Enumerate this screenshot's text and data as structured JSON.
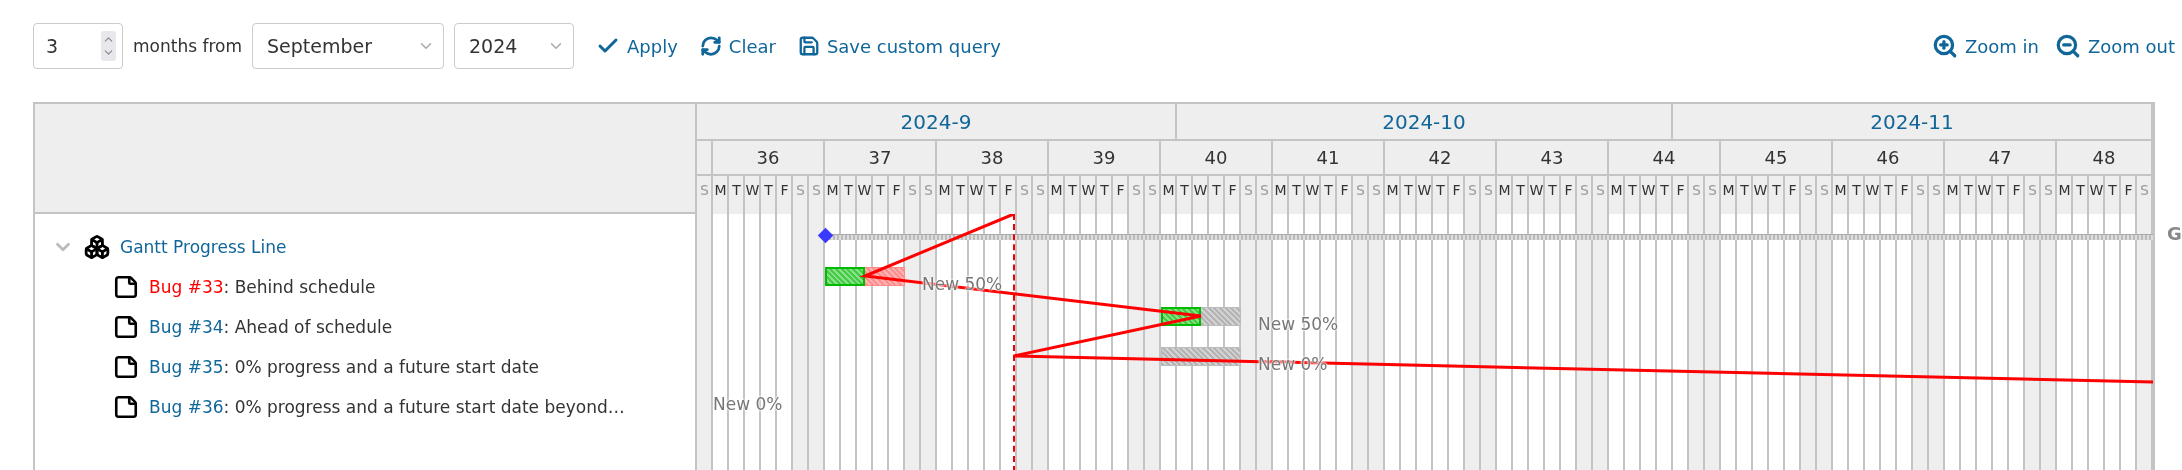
{
  "toolbar": {
    "months": "3",
    "months_label": "months from",
    "month_select": "September",
    "year_select": "2024",
    "actions": [
      {
        "kind": "apply",
        "label": "Apply"
      },
      {
        "kind": "clear",
        "label": "Clear"
      },
      {
        "kind": "save",
        "label": "Save custom query"
      }
    ],
    "zoom": [
      {
        "kind": "in",
        "label": "Zoom in"
      },
      {
        "kind": "out",
        "label": "Zoom out"
      }
    ]
  },
  "project": {
    "name": "Gantt Progress Line",
    "expanded": true,
    "bar_label": "G"
  },
  "issues": [
    {
      "link": "Bug #33",
      "subject": ": Behind schedule",
      "overdue": true,
      "level": 0.5,
      "status": "New 50%"
    },
    {
      "link": "Bug #34",
      "subject": ": Ahead of schedule",
      "overdue": false,
      "level": 0.5,
      "status": "New 50%"
    },
    {
      "link": "Bug #35",
      "subject": ": 0% progress and a future start date",
      "overdue": false,
      "status": "New 0%"
    },
    {
      "link": "Bug #36",
      "subject": ": 0% progress and a future start date beyond…",
      "overdue": false,
      "status": "New 0%"
    }
  ],
  "chart": {
    "months": [
      {
        "label": "2024-9"
      },
      {
        "label": "2024-10"
      },
      {
        "label": "2024-11"
      }
    ],
    "weeks": [
      {
        "days": [
          {
            "letter": "S",
            "weekend": true
          }
        ]
      },
      {
        "label": "36",
        "days": [
          {
            "letter": "M",
            "weekend": false
          },
          {
            "letter": "T",
            "weekend": false
          },
          {
            "letter": "W",
            "weekend": false
          },
          {
            "letter": "T",
            "weekend": false
          },
          {
            "letter": "F",
            "weekend": false
          },
          {
            "letter": "S",
            "weekend": true
          },
          {
            "letter": "S",
            "weekend": true
          }
        ]
      },
      {
        "label": "37",
        "days": [
          {
            "letter": "M",
            "weekend": false
          },
          {
            "letter": "T",
            "weekend": false
          },
          {
            "letter": "W",
            "weekend": false
          },
          {
            "letter": "T",
            "weekend": false
          },
          {
            "letter": "F",
            "weekend": false
          },
          {
            "letter": "S",
            "weekend": true
          },
          {
            "letter": "S",
            "weekend": true
          }
        ]
      },
      {
        "label": "38",
        "days": [
          {
            "letter": "M",
            "weekend": false
          },
          {
            "letter": "T",
            "weekend": false
          },
          {
            "letter": "W",
            "weekend": false
          },
          {
            "letter": "T",
            "weekend": false
          },
          {
            "letter": "F",
            "weekend": false
          },
          {
            "letter": "S",
            "weekend": true
          },
          {
            "letter": "S",
            "weekend": true
          }
        ]
      },
      {
        "label": "39",
        "days": [
          {
            "letter": "M",
            "weekend": false
          },
          {
            "letter": "T",
            "weekend": false
          },
          {
            "letter": "W",
            "weekend": false
          },
          {
            "letter": "T",
            "weekend": false
          },
          {
            "letter": "F",
            "weekend": false
          },
          {
            "letter": "S",
            "weekend": true
          },
          {
            "letter": "S",
            "weekend": true
          }
        ]
      },
      {
        "label": "40",
        "days": [
          {
            "letter": "M",
            "weekend": false
          },
          {
            "letter": "T",
            "weekend": false
          },
          {
            "letter": "W",
            "weekend": false
          },
          {
            "letter": "T",
            "weekend": false
          },
          {
            "letter": "F",
            "weekend": false
          },
          {
            "letter": "S",
            "weekend": true
          },
          {
            "letter": "S",
            "weekend": true
          }
        ]
      },
      {
        "label": "41",
        "days": [
          {
            "letter": "M",
            "weekend": false
          },
          {
            "letter": "T",
            "weekend": false
          },
          {
            "letter": "W",
            "weekend": false
          },
          {
            "letter": "T",
            "weekend": false
          },
          {
            "letter": "F",
            "weekend": false
          },
          {
            "letter": "S",
            "weekend": true
          },
          {
            "letter": "S",
            "weekend": true
          }
        ]
      },
      {
        "label": "42",
        "days": [
          {
            "letter": "M",
            "weekend": false
          },
          {
            "letter": "T",
            "weekend": false
          },
          {
            "letter": "W",
            "weekend": false
          },
          {
            "letter": "T",
            "weekend": false
          },
          {
            "letter": "F",
            "weekend": false
          },
          {
            "letter": "S",
            "weekend": true
          },
          {
            "letter": "S",
            "weekend": true
          }
        ]
      },
      {
        "label": "43",
        "days": [
          {
            "letter": "M",
            "weekend": false
          },
          {
            "letter": "T",
            "weekend": false
          },
          {
            "letter": "W",
            "weekend": false
          },
          {
            "letter": "T",
            "weekend": false
          },
          {
            "letter": "F",
            "weekend": false
          },
          {
            "letter": "S",
            "weekend": true
          },
          {
            "letter": "S",
            "weekend": true
          }
        ]
      },
      {
        "label": "44",
        "days": [
          {
            "letter": "M",
            "weekend": false
          },
          {
            "letter": "T",
            "weekend": false
          },
          {
            "letter": "W",
            "weekend": false
          },
          {
            "letter": "T",
            "weekend": false
          },
          {
            "letter": "F",
            "weekend": false
          },
          {
            "letter": "S",
            "weekend": true
          },
          {
            "letter": "S",
            "weekend": true
          }
        ]
      },
      {
        "label": "45",
        "days": [
          {
            "letter": "M",
            "weekend": false
          },
          {
            "letter": "T",
            "weekend": false
          },
          {
            "letter": "W",
            "weekend": false
          },
          {
            "letter": "T",
            "weekend": false
          },
          {
            "letter": "F",
            "weekend": false
          },
          {
            "letter": "S",
            "weekend": true
          },
          {
            "letter": "S",
            "weekend": true
          }
        ]
      },
      {
        "label": "46",
        "days": [
          {
            "letter": "M",
            "weekend": false
          },
          {
            "letter": "T",
            "weekend": false
          },
          {
            "letter": "W",
            "weekend": false
          },
          {
            "letter": "T",
            "weekend": false
          },
          {
            "letter": "F",
            "weekend": false
          },
          {
            "letter": "S",
            "weekend": true
          },
          {
            "letter": "S",
            "weekend": true
          }
        ]
      },
      {
        "label": "47",
        "days": [
          {
            "letter": "M",
            "weekend": false
          },
          {
            "letter": "T",
            "weekend": false
          },
          {
            "letter": "W",
            "weekend": false
          },
          {
            "letter": "T",
            "weekend": false
          },
          {
            "letter": "F",
            "weekend": false
          },
          {
            "letter": "S",
            "weekend": true
          },
          {
            "letter": "S",
            "weekend": true
          }
        ]
      },
      {
        "label": "48",
        "days": [
          {
            "letter": "M",
            "weekend": false
          },
          {
            "letter": "T",
            "weekend": false
          },
          {
            "letter": "W",
            "weekend": false
          },
          {
            "letter": "T",
            "weekend": false
          },
          {
            "letter": "F",
            "weekend": false
          },
          {
            "letter": "S",
            "weekend": true
          }
        ]
      }
    ]
  }
}
